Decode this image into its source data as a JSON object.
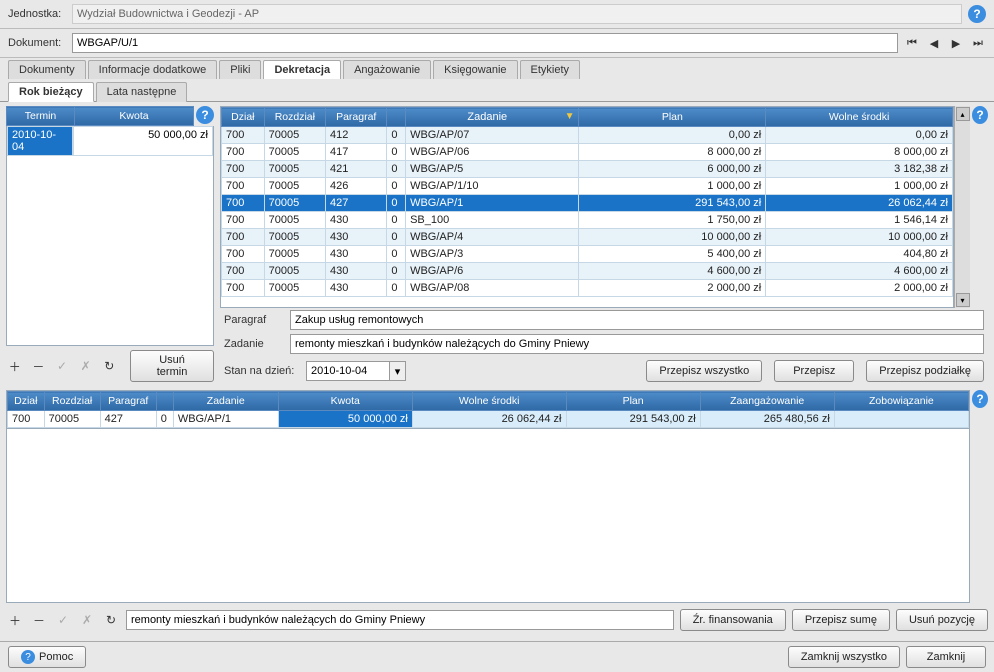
{
  "labels": {
    "jednostka": "Jednostka:",
    "dokument": "Dokument:",
    "paragraf": "Paragraf",
    "zadanie": "Zadanie",
    "stan": "Stan na dzień:",
    "pomoc": "Pomoc"
  },
  "jednostka": "Wydział Budownictwa i Geodezji - AP",
  "dokument": "WBGAP/U/1",
  "main_tabs": [
    "Dokumenty",
    "Informacje dodatkowe",
    "Pliki",
    "Dekretacja",
    "Angażowanie",
    "Księgowanie",
    "Etykiety"
  ],
  "main_tab_active": 3,
  "sub_tabs": [
    "Rok bieżący",
    "Lata następne"
  ],
  "sub_tab_active": 0,
  "termin_headers": [
    "Termin",
    "Kwota"
  ],
  "termin_rows": [
    {
      "termin": "2010-10-04",
      "kwota": "50 000,00 zł"
    }
  ],
  "plan_headers": [
    "Dział",
    "Rozdział",
    "Paragraf",
    "",
    "Zadanie",
    "Plan",
    "Wolne środki"
  ],
  "plan_rows": [
    {
      "dzial": "700",
      "rozdzial": "70005",
      "par": "412",
      "n": "0",
      "zad": "WBG/AP/07",
      "plan": "0,00 zł",
      "wol": "0,00 zł",
      "sel": false
    },
    {
      "dzial": "700",
      "rozdzial": "70005",
      "par": "417",
      "n": "0",
      "zad": "WBG/AP/06",
      "plan": "8 000,00 zł",
      "wol": "8 000,00 zł",
      "sel": false
    },
    {
      "dzial": "700",
      "rozdzial": "70005",
      "par": "421",
      "n": "0",
      "zad": "WBG/AP/5",
      "plan": "6 000,00 zł",
      "wol": "3 182,38 zł",
      "sel": false
    },
    {
      "dzial": "700",
      "rozdzial": "70005",
      "par": "426",
      "n": "0",
      "zad": "WBG/AP/1/10",
      "plan": "1 000,00 zł",
      "wol": "1 000,00 zł",
      "sel": false
    },
    {
      "dzial": "700",
      "rozdzial": "70005",
      "par": "427",
      "n": "0",
      "zad": "WBG/AP/1",
      "plan": "291 543,00 zł",
      "wol": "26 062,44 zł",
      "sel": true
    },
    {
      "dzial": "700",
      "rozdzial": "70005",
      "par": "430",
      "n": "0",
      "zad": "SB_100",
      "plan": "1 750,00 zł",
      "wol": "1 546,14 zł",
      "sel": false
    },
    {
      "dzial": "700",
      "rozdzial": "70005",
      "par": "430",
      "n": "0",
      "zad": "WBG/AP/4",
      "plan": "10 000,00 zł",
      "wol": "10 000,00 zł",
      "sel": false
    },
    {
      "dzial": "700",
      "rozdzial": "70005",
      "par": "430",
      "n": "0",
      "zad": "WBG/AP/3",
      "plan": "5 400,00 zł",
      "wol": "404,80 zł",
      "sel": false
    },
    {
      "dzial": "700",
      "rozdzial": "70005",
      "par": "430",
      "n": "0",
      "zad": "WBG/AP/6",
      "plan": "4 600,00 zł",
      "wol": "4 600,00 zł",
      "sel": false
    },
    {
      "dzial": "700",
      "rozdzial": "70005",
      "par": "430",
      "n": "0",
      "zad": "WBG/AP/08",
      "plan": "2 000,00 zł",
      "wol": "2 000,00 zł",
      "sel": false
    }
  ],
  "paragraf_tekst": "Zakup usług remontowych",
  "zadanie_tekst": "remonty mieszkań i budynków należących do Gminy Pniewy",
  "stan_data": "2010-10-04",
  "buttons": {
    "usun_termin": "Usuń termin",
    "przepisz_wszystko": "Przepisz wszystko",
    "przepisz": "Przepisz",
    "przepisz_podzialke": "Przepisz podziałkę",
    "zr_finansowania": "Źr. finansowania",
    "przepisz_sume": "Przepisz sumę",
    "usun_pozycje": "Usuń pozycję",
    "zamknij_wszystko": "Zamknij wszystko",
    "zamknij": "Zamknij"
  },
  "dek_headers": [
    "Dział",
    "Rozdział",
    "Paragraf",
    "",
    "Zadanie",
    "Kwota",
    "Wolne środki",
    "Plan",
    "Zaangażowanie",
    "Zobowiązanie"
  ],
  "dek_rows": [
    {
      "dzial": "700",
      "rozdzial": "70005",
      "par": "427",
      "n": "0",
      "zad": "WBG/AP/1",
      "kwota": "50 000,00 zł",
      "wol": "26 062,44 zł",
      "plan": "291 543,00 zł",
      "zang": "265 480,56 zł",
      "zob": ""
    }
  ],
  "bottom_input": "remonty mieszkań i budynków należących do Gminy Pniewy"
}
